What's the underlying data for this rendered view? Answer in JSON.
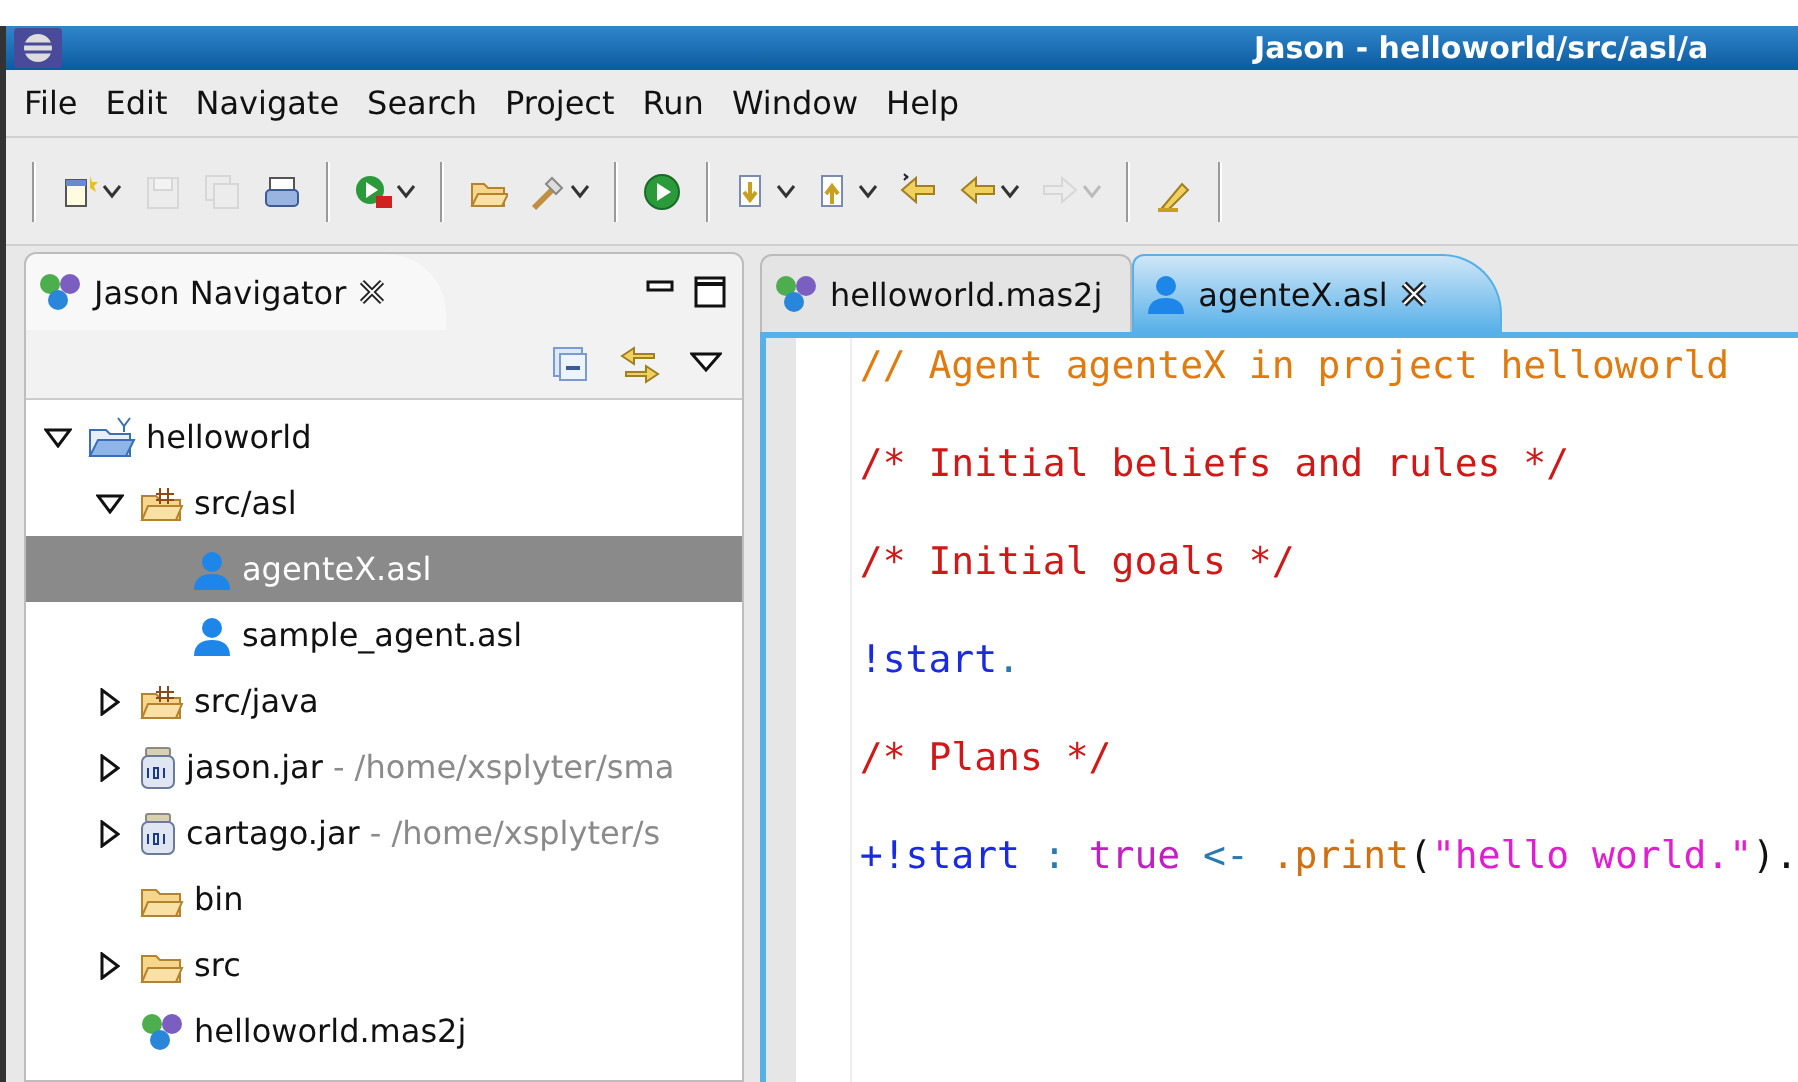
{
  "window": {
    "title": "Jason - helloworld/src/asl/a"
  },
  "menu": [
    {
      "label": "File"
    },
    {
      "label": "Edit"
    },
    {
      "label": "Navigate"
    },
    {
      "label": "Search"
    },
    {
      "label": "Project"
    },
    {
      "label": "Run"
    },
    {
      "label": "Window"
    },
    {
      "label": "Help"
    }
  ],
  "toolbar": [
    [
      {
        "disabled": false,
        "dropdown": true
      },
      {
        "disabled": true,
        "dropdown": false
      },
      {
        "disabled": true,
        "dropdown": false
      },
      {
        "disabled": false,
        "dropdown": false
      }
    ],
    [
      {
        "disabled": false,
        "dropdown": true
      }
    ],
    [
      {
        "disabled": false,
        "dropdown": false
      },
      {
        "disabled": false,
        "dropdown": true
      }
    ],
    [
      {
        "disabled": false,
        "dropdown": false
      }
    ],
    [
      {
        "disabled": false,
        "dropdown": true
      },
      {
        "disabled": false,
        "dropdown": true
      },
      {
        "disabled": false,
        "dropdown": false
      },
      {
        "disabled": false,
        "dropdown": true
      },
      {
        "disabled": true,
        "dropdown": true
      }
    ],
    [
      {
        "disabled": false,
        "dropdown": false
      }
    ]
  ],
  "navigator": {
    "title": "Jason Navigator",
    "tree": [
      {
        "label": "helloworld",
        "kind": "project",
        "expanded": true,
        "selected": false,
        "children": [
          {
            "label": "src/asl",
            "kind": "package",
            "expanded": true,
            "selected": false,
            "children": [
              {
                "label": "agenteX.asl",
                "kind": "agent",
                "selected": true
              },
              {
                "label": "sample_agent.asl",
                "kind": "agent",
                "selected": false
              }
            ]
          },
          {
            "label": "src/java",
            "kind": "package",
            "expanded": false,
            "selected": false
          },
          {
            "label": "jason.jar",
            "path": "- /home/xsplyter/sma",
            "kind": "jar",
            "expanded": false,
            "selected": false
          },
          {
            "label": "cartago.jar",
            "path": "- /home/xsplyter/s",
            "kind": "jar",
            "expanded": false,
            "selected": false
          },
          {
            "label": "bin",
            "kind": "folder",
            "selected": false
          },
          {
            "label": "src",
            "kind": "folder",
            "expanded": false,
            "selected": false
          },
          {
            "label": "helloworld.mas2j",
            "kind": "mas",
            "selected": false
          }
        ]
      }
    ]
  },
  "editor": {
    "tabs": [
      {
        "label": "helloworld.mas2j",
        "kind": "mas",
        "selected": false
      },
      {
        "label": "agenteX.asl",
        "kind": "agent",
        "selected": true
      }
    ],
    "lines": [
      [
        {
          "text": "// Agent agenteX in project helloworld",
          "kind": "line-comment"
        }
      ],
      [
        {
          "text": "/* Initial beliefs and rules */",
          "kind": "block-comment"
        }
      ],
      [
        {
          "text": "/* Initial goals */",
          "kind": "block-comment"
        }
      ],
      [
        {
          "text": "!start",
          "kind": "goal"
        },
        {
          "text": ".",
          "kind": "operator"
        }
      ],
      [
        {
          "text": "/* Plans */",
          "kind": "block-comment"
        }
      ],
      [
        {
          "text": "+!start",
          "kind": "goal"
        },
        {
          "text": " : ",
          "kind": "operator"
        },
        {
          "text": "true",
          "kind": "keyword"
        },
        {
          "text": " <- ",
          "kind": "operator"
        },
        {
          "text": ".print",
          "kind": "action"
        },
        {
          "text": "(",
          "kind": "punct"
        },
        {
          "text": "\"hello world.\"",
          "kind": "string"
        },
        {
          "text": ").",
          "kind": "punct"
        }
      ]
    ]
  }
}
